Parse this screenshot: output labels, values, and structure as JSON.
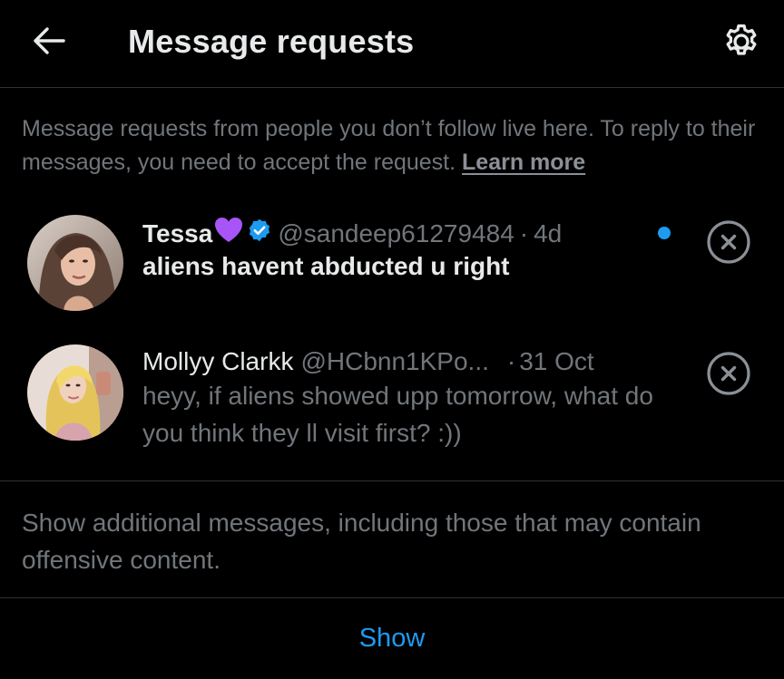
{
  "header": {
    "title": "Message requests",
    "back_icon": "arrow-left-icon",
    "settings_icon": "gear-icon"
  },
  "intro": {
    "text": "Message requests from people you don’t follow live here. To reply to their messages, you need to accept the request.",
    "link": "Learn more"
  },
  "requests": [
    {
      "name": "Tessa",
      "name_emoji": "purple-heart-icon",
      "verified": true,
      "handle": "@sandeep61279484",
      "separator": "·",
      "time": "4d",
      "message": "aliens havent abducted u right",
      "unread": true
    },
    {
      "name": "Mollyy Clarkk",
      "handle": "@HCbnn1KPo...",
      "separator": "·",
      "time": "31 Oct",
      "message": "heyy, if aliens showed upp tomorrow, what do you think they ll visit first? :))",
      "unread": false
    }
  ],
  "additional": {
    "text": "Show additional messages, including those that may contain offensive content.",
    "button": "Show"
  },
  "colors": {
    "background": "#000000",
    "text_primary": "#e7e9ea",
    "text_secondary": "#71767b",
    "accent": "#1d9bf0",
    "divider": "#2f3336",
    "heart": "#a855f7"
  }
}
